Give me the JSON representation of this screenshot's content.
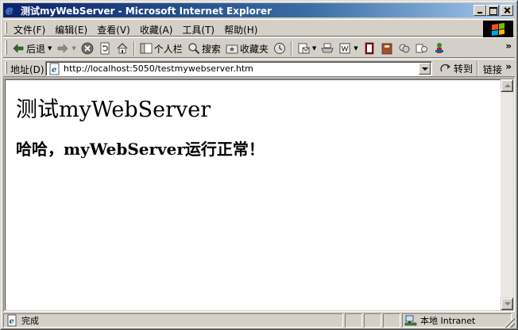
{
  "window": {
    "title": "测试myWebServer - Microsoft Internet Explorer",
    "icon": "ie-logo-icon"
  },
  "menu": {
    "items": [
      {
        "label": "文件(F)"
      },
      {
        "label": "编辑(E)"
      },
      {
        "label": "查看(V)"
      },
      {
        "label": "收藏(A)"
      },
      {
        "label": "工具(T)"
      },
      {
        "label": "帮助(H)"
      }
    ]
  },
  "toolbar": {
    "back_label": "后退",
    "personal_bar_label": "个人栏",
    "search_label": "搜索",
    "favorites_label": "收藏夹",
    "overflow": "»"
  },
  "address": {
    "label": "地址(D)",
    "url": "http://localhost:5050/testmywebserver.htm",
    "go_label": "转到",
    "links_label": "链接",
    "links_overflow": "»"
  },
  "page": {
    "heading": "测试myWebServer",
    "message": "哈哈，myWebServer运行正常！"
  },
  "status": {
    "text": "完成",
    "zone": "本地 Intranet"
  },
  "colors": {
    "titlebar_start": "#0a246a",
    "titlebar_end": "#a6caf0",
    "chrome": "#d4d0c8"
  }
}
